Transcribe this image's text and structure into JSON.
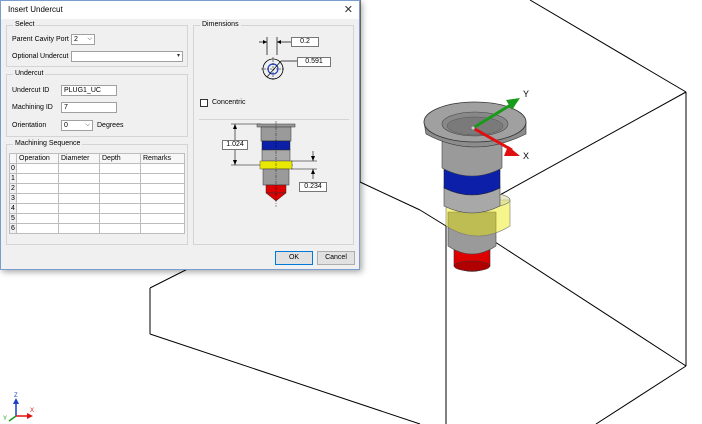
{
  "dialog": {
    "title": "Insert Undercut",
    "select": {
      "label": "Select",
      "parent_cavity_port_label": "Parent Cavity Port",
      "parent_cavity_port_value": "2",
      "optional_undercut_label": "Optional Undercut",
      "optional_undercut_value": ""
    },
    "undercut": {
      "label": "Undercut",
      "undercut_id_label": "Undercut ID",
      "undercut_id_value": "PLUG1_UC",
      "machining_id_label": "Machining ID",
      "machining_id_value": "7",
      "orientation_label": "Orientation",
      "orientation_value": "0",
      "orientation_unit": "Degrees"
    },
    "machining_sequence": {
      "label": "Machining Sequence",
      "columns": [
        "Operation",
        "Diameter",
        "Depth",
        "Remarks"
      ],
      "row_numbers": [
        "0",
        "1",
        "2",
        "3",
        "4",
        "5",
        "6"
      ]
    },
    "dimensions": {
      "label": "Dimensions",
      "value_top": "0.2",
      "value_diameter": "0.591",
      "concentric_label": "Concentric",
      "concentric_checked": false,
      "value_depth": "1.024",
      "value_width": "0.234"
    },
    "buttons": {
      "ok": "OK",
      "cancel": "Cancel"
    }
  },
  "viewport": {
    "axis_y": "Y",
    "axis_x": "X",
    "triad_z": "Z",
    "triad_x": "X",
    "triad_y": "Y"
  },
  "colors": {
    "body_gray": "#9a9a9a",
    "band_blue": "#0b1fa8",
    "band_yellow": "#e8e800",
    "tip_red": "#dd0000",
    "axis_green": "#1a9a1a",
    "axis_red": "#e01010",
    "accent_blue": "#0078d7"
  }
}
